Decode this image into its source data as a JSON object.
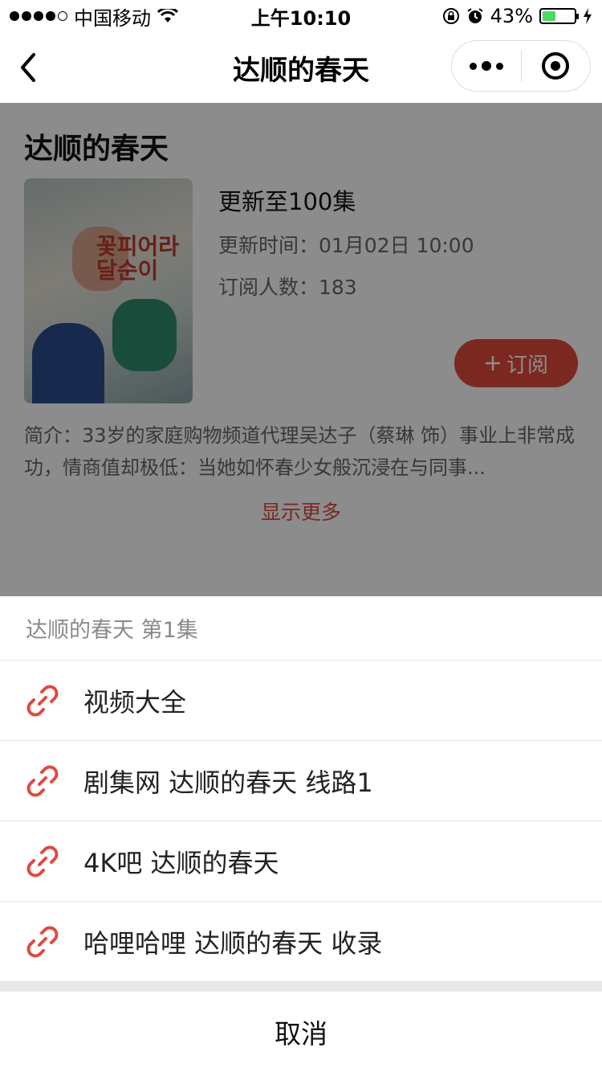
{
  "statusbar": {
    "carrier": "中国移动",
    "time": "上午10:10",
    "battery_percent": "43%",
    "battery_level": 0.43
  },
  "navbar": {
    "title": "达顺的春天"
  },
  "show": {
    "title": "达顺的春天",
    "episodes": "更新至100集",
    "update_time": "更新时间：01月02日 10:00",
    "subscribers": "订阅人数：183",
    "subscribe_label": "订阅",
    "description": "简介：33岁的家庭购物频道代理吴达子（蔡琳 饰）事业上非常成功，情商值却极低：当她如怀春少女般沉浸在与同事...",
    "show_more": "显示更多",
    "poster_text": "꽃피어라 달순이"
  },
  "sheet": {
    "title": "达顺的春天 第1集",
    "items": [
      {
        "label": "视频大全"
      },
      {
        "label": "剧集网 达顺的春天 线路1"
      },
      {
        "label": "4K吧 达顺的春天"
      },
      {
        "label": "哈哩哈哩 达顺的春天 收录"
      }
    ],
    "cancel_label": "取消"
  },
  "colors": {
    "accent": "#e04a3c",
    "battery": "#4cd964"
  }
}
